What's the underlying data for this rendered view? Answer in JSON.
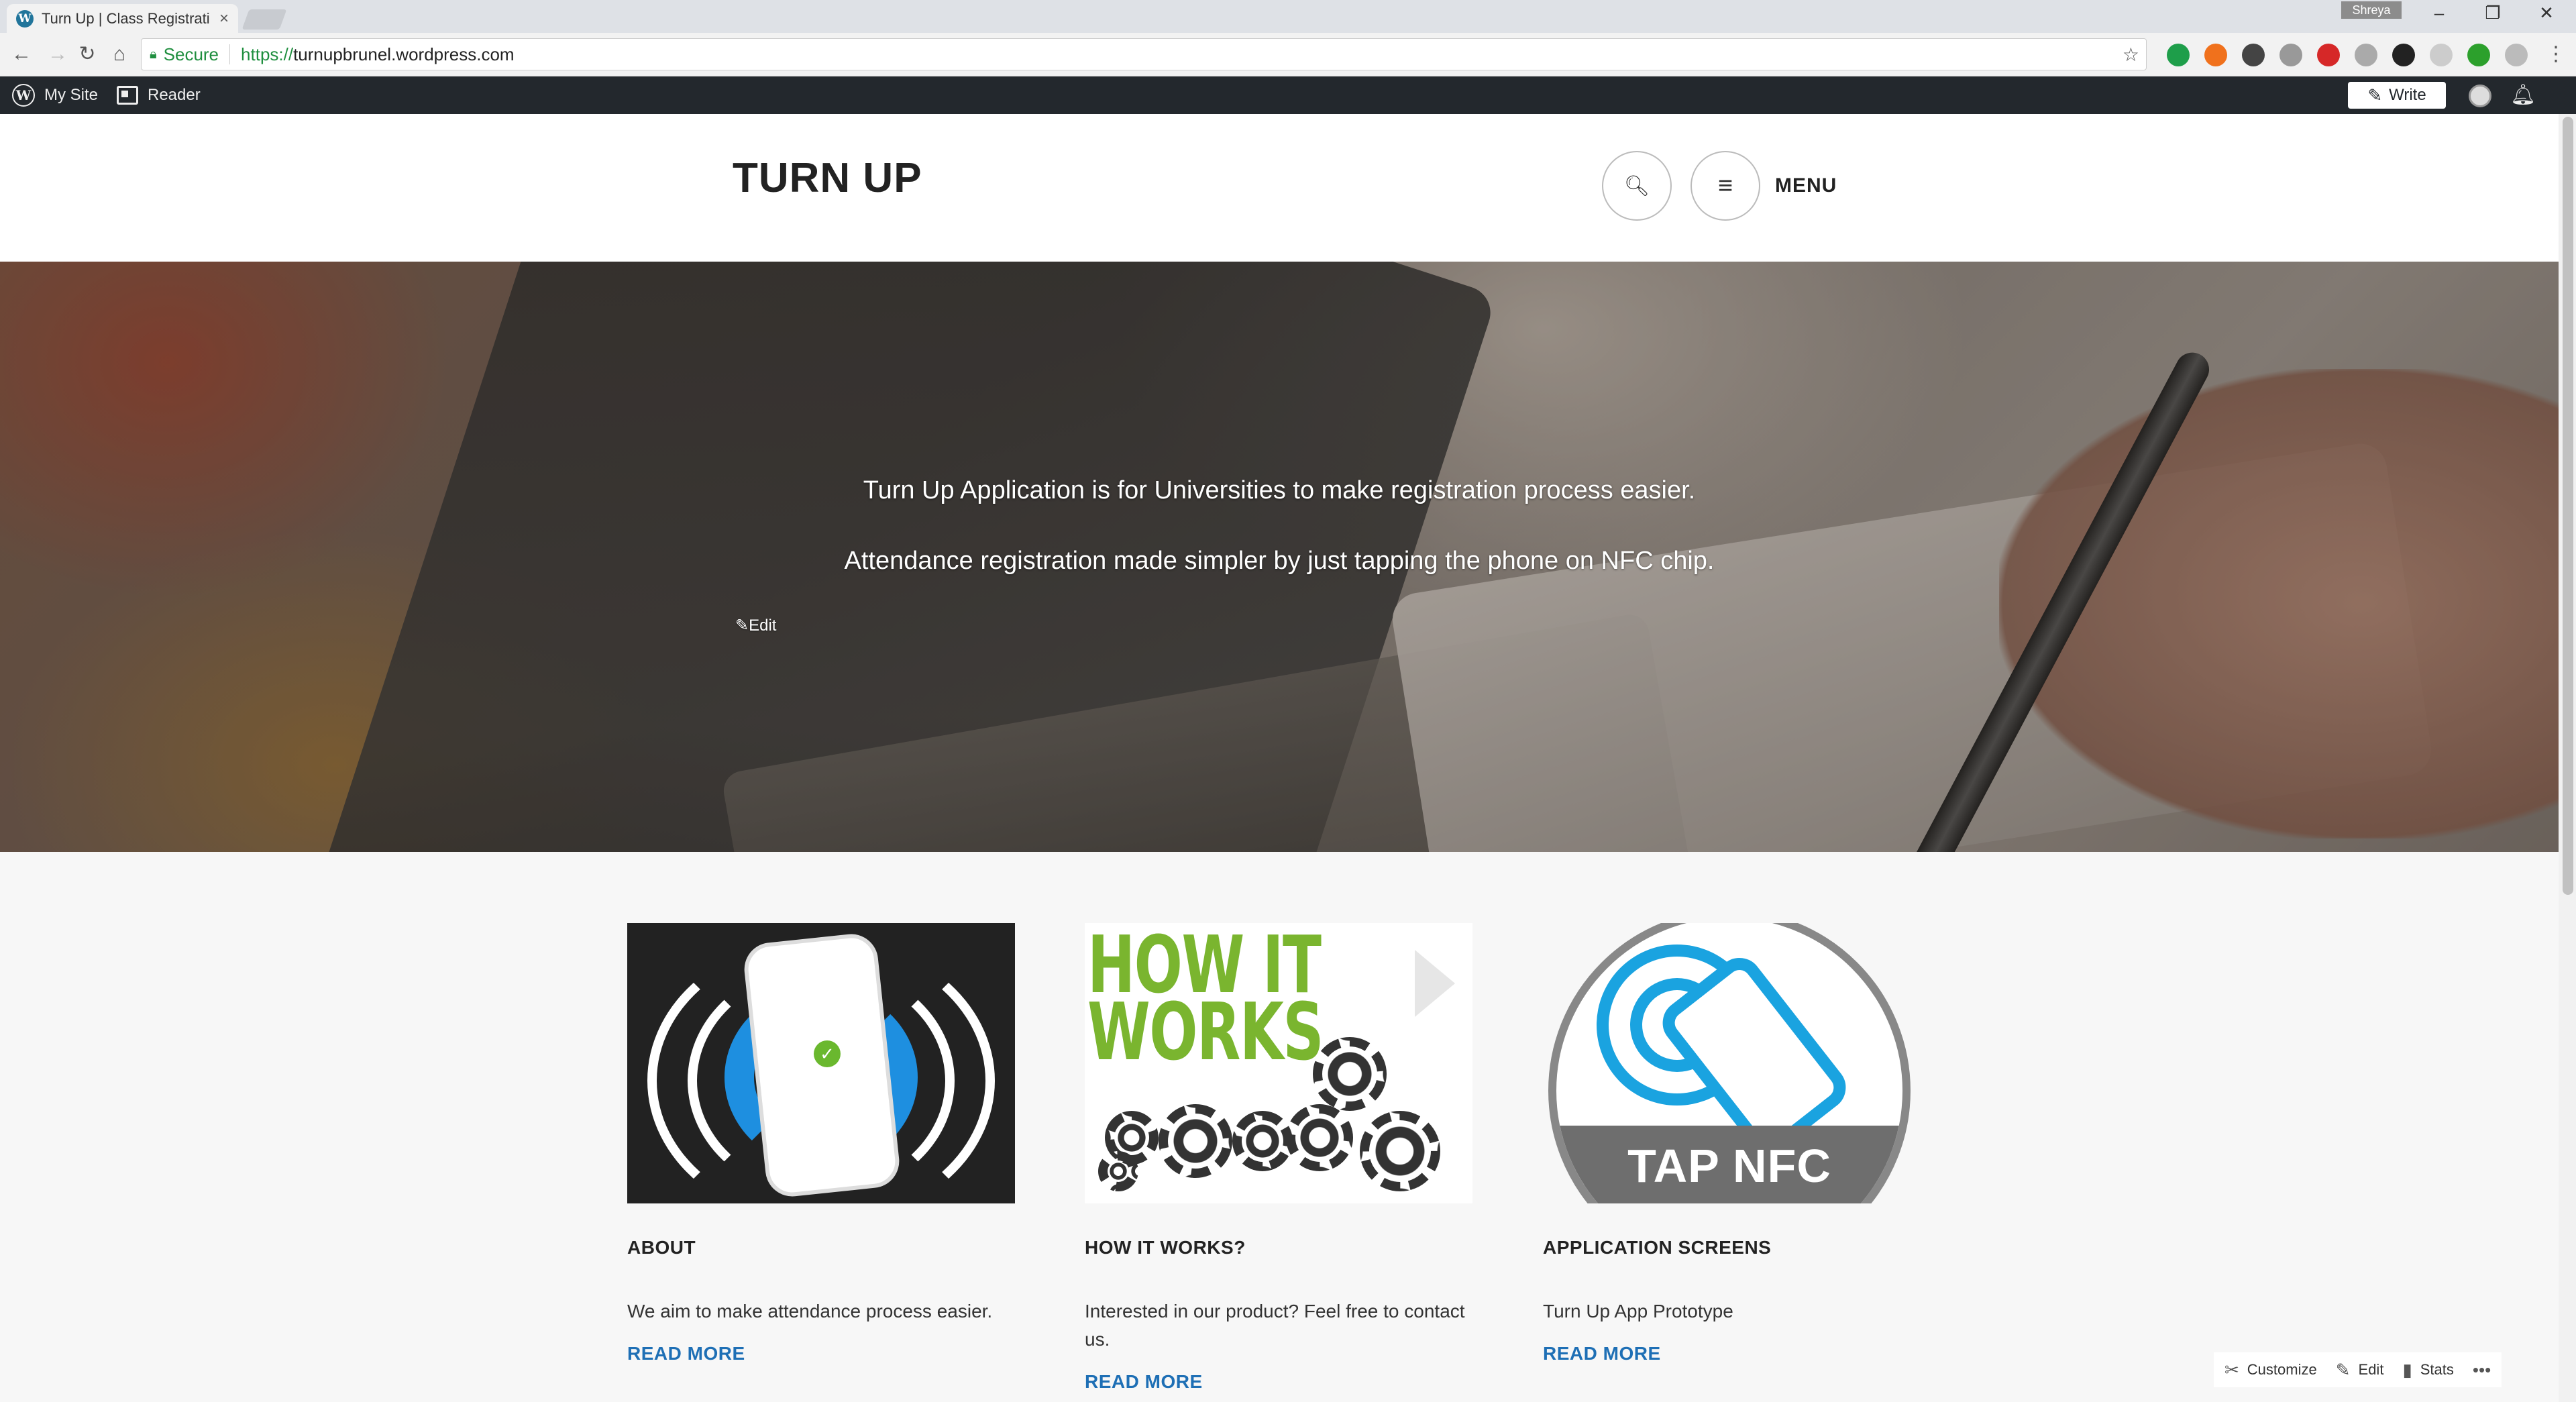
{
  "browser": {
    "tab_title": "Turn Up | Class Registrati",
    "favicon_letter": "W",
    "profile_name": "Shreya",
    "secure_label": "Secure",
    "url_scheme": "https://",
    "url_host": "turnupbrunel.wordpress.com"
  },
  "admin_bar": {
    "my_site": "My Site",
    "reader": "Reader",
    "write": "Write"
  },
  "site": {
    "title": "TURN UP",
    "menu_label": "MENU"
  },
  "hero": {
    "line1": "Turn Up Application is for Universities to make registration process easier.",
    "line2": "Attendance registration made simpler by just tapping the phone on NFC chip.",
    "edit": "Edit"
  },
  "cards": [
    {
      "title": "ABOUT",
      "text": "We aim to make attendance process easier.",
      "more": "READ MORE"
    },
    {
      "title": "HOW IT WORKS?",
      "text": "Interested in our product? Feel free to contact us.",
      "more": "READ MORE",
      "image_text_1": "HOW IT",
      "image_text_2": "WORKS"
    },
    {
      "title": "APPLICATION SCREENS",
      "text": "Turn Up App Prototype",
      "more": "READ MORE",
      "image_text": "TAP NFC"
    }
  ],
  "customizer": {
    "customize": "Customize",
    "edit": "Edit",
    "stats": "Stats"
  },
  "colors": {
    "link_blue": "#1e6fb5",
    "admin_bar": "#23282d",
    "nfc_blue": "#1aa3e0",
    "how_green": "#7ab52f"
  }
}
